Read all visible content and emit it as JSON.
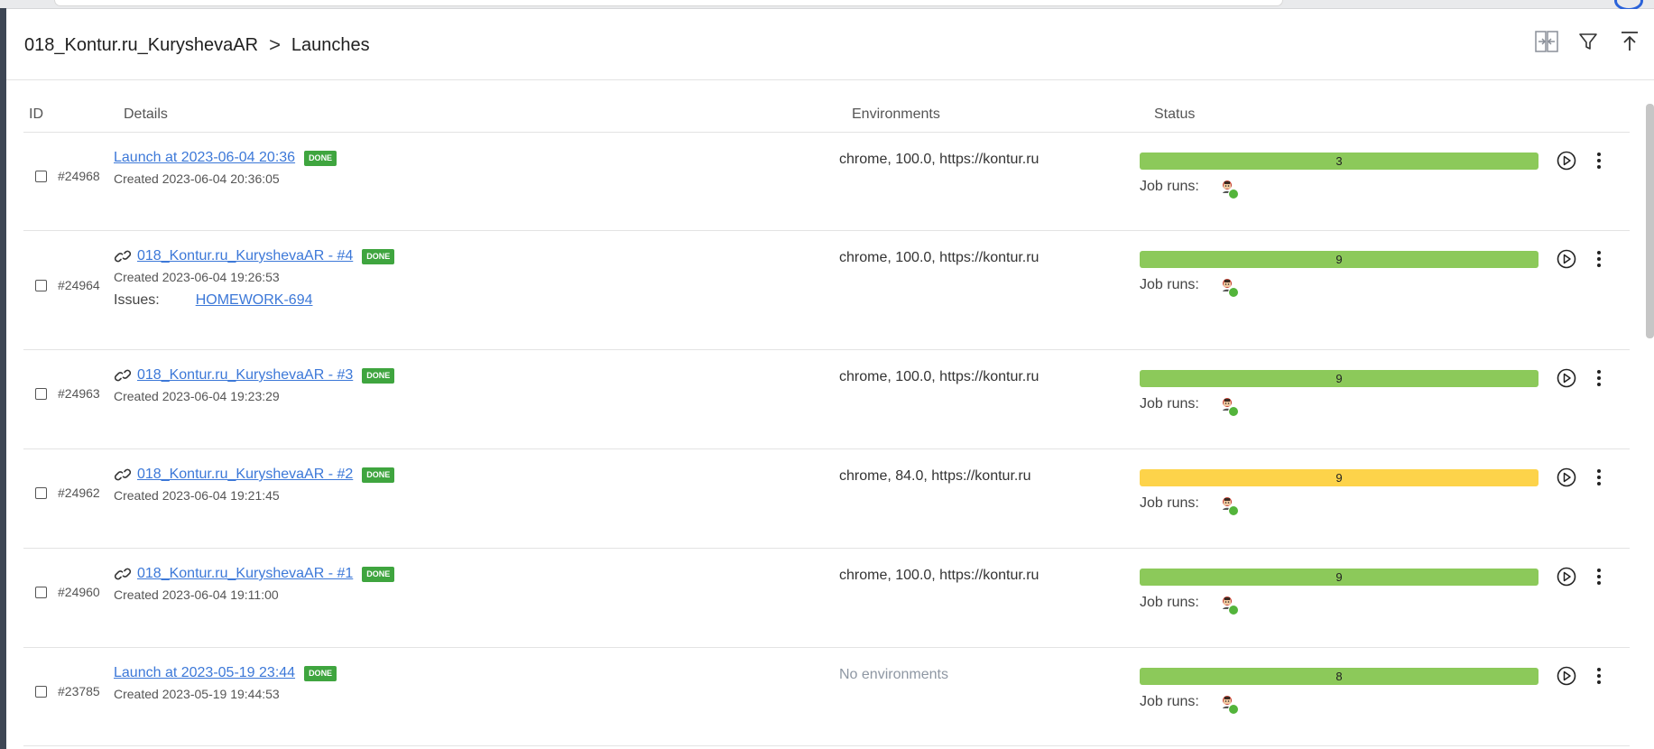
{
  "breadcrumb": {
    "project": "018_Kontur.ru_KuryshevaAR",
    "separator": ">",
    "page": "Launches"
  },
  "header_icons": [
    "compare-icon",
    "filter-icon",
    "upload-icon"
  ],
  "columns": {
    "id": "ID",
    "details": "Details",
    "environments": "Environments",
    "status": "Status"
  },
  "job_runs_label": "Job runs:",
  "issues_label": "Issues:",
  "done_badge": "DONE",
  "colors": {
    "link": "#3c78d8",
    "done": "#3fa53f",
    "bar_green": "#8cc95a",
    "bar_yellow": "#fdd34a"
  },
  "launches": [
    {
      "id": "#24968",
      "title": "Launch at 2023-06-04 20:36",
      "has_link_icon": false,
      "created": "Created 2023-06-04 20:36:05",
      "issue": null,
      "env": "chrome, 100.0, https://kontur.ru",
      "status_count": "3",
      "status_color": "green"
    },
    {
      "id": "#24964",
      "title": "018_Kontur.ru_KuryshevaAR - #4",
      "has_link_icon": true,
      "created": "Created 2023-06-04 19:26:53",
      "issue": "HOMEWORK-694",
      "env": "chrome, 100.0, https://kontur.ru",
      "status_count": "9",
      "status_color": "green"
    },
    {
      "id": "#24963",
      "title": "018_Kontur.ru_KuryshevaAR - #3",
      "has_link_icon": true,
      "created": "Created 2023-06-04 19:23:29",
      "issue": null,
      "env": "chrome, 100.0, https://kontur.ru",
      "status_count": "9",
      "status_color": "green"
    },
    {
      "id": "#24962",
      "title": "018_Kontur.ru_KuryshevaAR - #2",
      "has_link_icon": true,
      "created": "Created 2023-06-04 19:21:45",
      "issue": null,
      "env": "chrome, 84.0, https://kontur.ru",
      "status_count": "9",
      "status_color": "yellow"
    },
    {
      "id": "#24960",
      "title": "018_Kontur.ru_KuryshevaAR - #1",
      "has_link_icon": true,
      "created": "Created 2023-06-04 19:11:00",
      "issue": null,
      "env": "chrome, 100.0, https://kontur.ru",
      "status_count": "9",
      "status_color": "green"
    },
    {
      "id": "#23785",
      "title": "Launch at 2023-05-19 23:44",
      "has_link_icon": false,
      "created": "Created 2023-05-19 19:44:53",
      "issue": null,
      "env": "No environments",
      "env_empty": true,
      "status_count": "8",
      "status_color": "green"
    }
  ]
}
